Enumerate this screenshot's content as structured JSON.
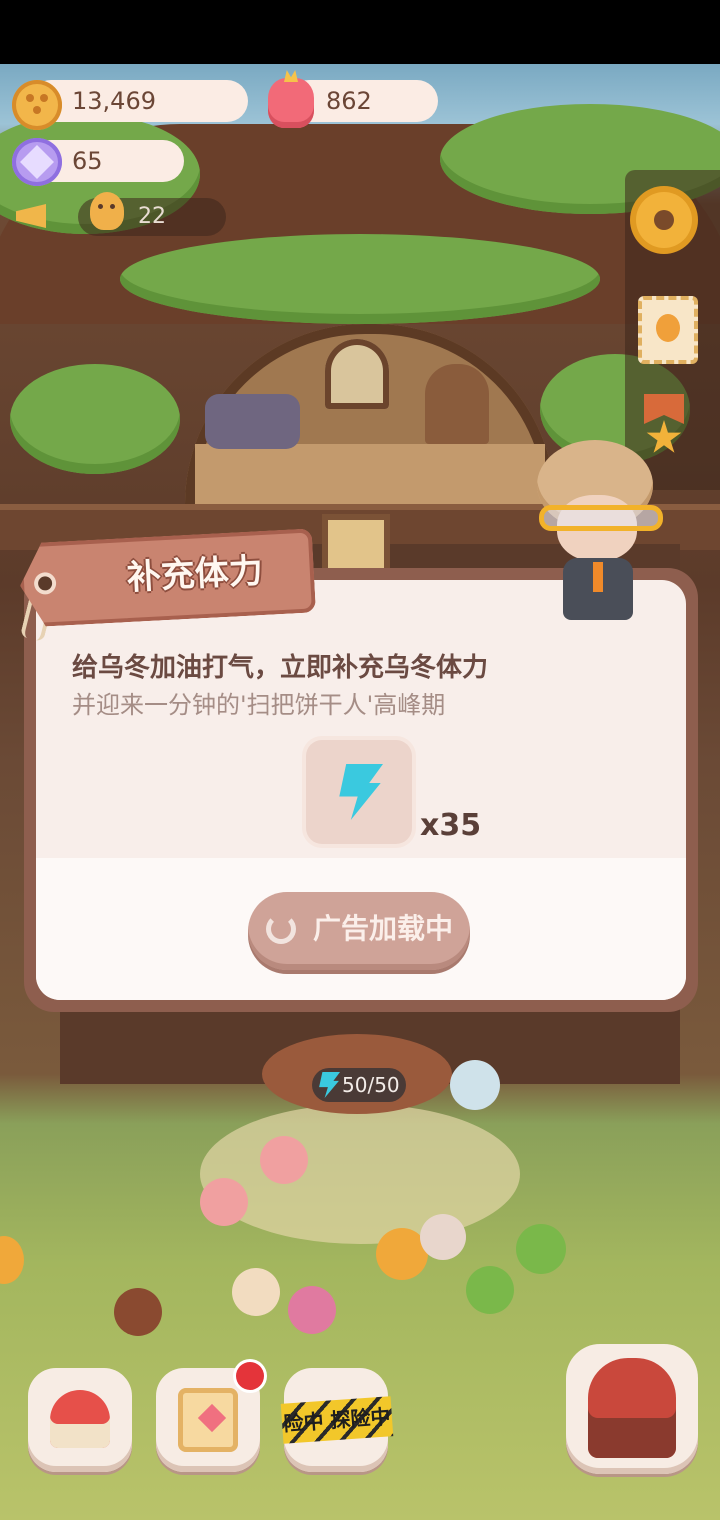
{
  "hud": {
    "coins": "13,469",
    "jelly": "862",
    "crystals": "65",
    "cookie_count": "22"
  },
  "dialog": {
    "title": "补充体力",
    "line1": "给乌冬加油打气，立即补充乌冬体力",
    "line2": "并迎来一分钟的'扫把饼干人'高峰期",
    "reward_qty": "x35",
    "ad_button_label": "广告加载中"
  },
  "scene": {
    "stamina": "50/50"
  },
  "bottom_nav": {
    "adventure_tape": "险中 探险中"
  },
  "icons": [
    "coin-icon",
    "jelly-icon",
    "crystal-icon",
    "megaphone-icon",
    "cookie-icon",
    "gear-icon",
    "stamp-icon",
    "medal-icon",
    "bolt-icon",
    "spinner-icon",
    "hotel-icon",
    "diary-icon",
    "circus-icon"
  ],
  "colors": {
    "accent_tag": "#c98470",
    "dialog_bg": "#f8eeea",
    "button": "#cfa398",
    "bolt": "#3ac9df"
  }
}
